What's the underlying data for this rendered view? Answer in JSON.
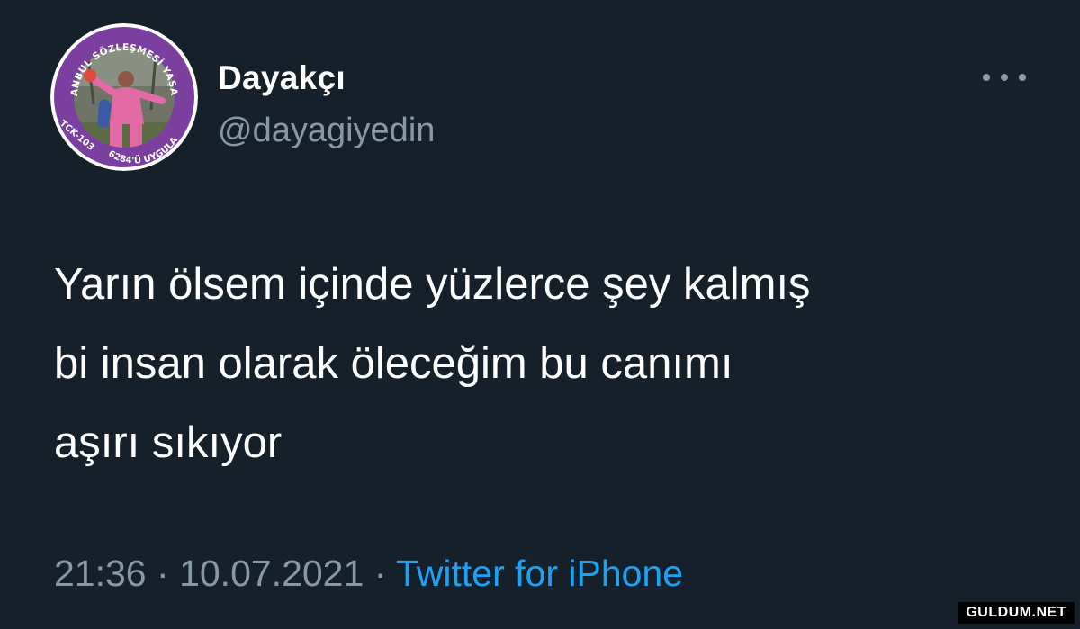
{
  "tweet": {
    "display_name": "Dayakçı",
    "handle": "@dayagiyedin",
    "more_icon": "more-horizontal-icon",
    "text_lines": [
      "Yarın ölsem içinde yüzlerce şey kalmış",
      "bi insan olarak öleceğim bu canımı",
      "aşırı sıkıyor"
    ],
    "time": "21:36",
    "separator": "·",
    "date": "10.07.2021",
    "source": "Twitter for iPhone"
  },
  "avatar": {
    "badge_top_text": "İSTANBUL SÖZLEŞMESİ YAŞATIR",
    "badge_left_text": "TCK-103",
    "badge_bottom_text": "6284'Ü UYGULA",
    "ring_color": "#7b3fa0"
  },
  "watermark": "GULDUM.NET",
  "colors": {
    "background": "#15202b",
    "primary_text": "#ffffff",
    "secondary_text": "#8899a6",
    "link": "#1da1f2"
  }
}
